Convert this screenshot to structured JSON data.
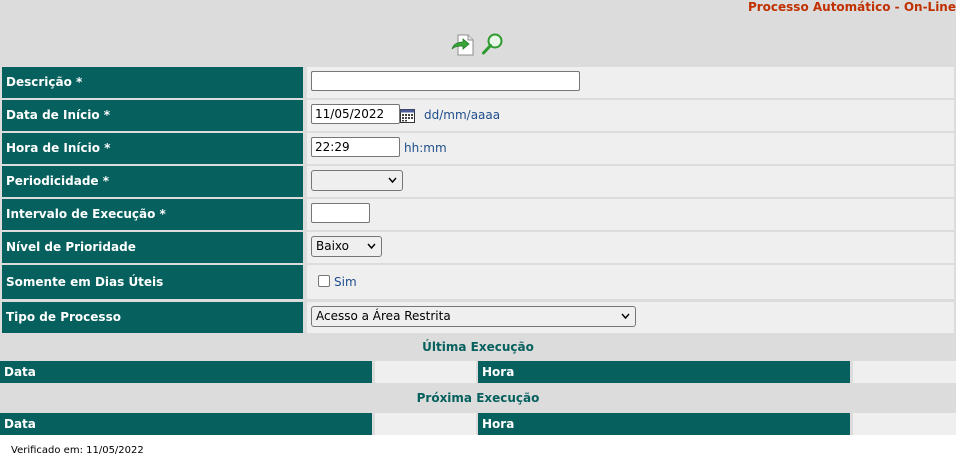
{
  "header": {
    "title": "Processo Automático - On-Line",
    "toolbar_icons": [
      "new-document-icon",
      "search-icon"
    ]
  },
  "colors": {
    "accent": "#05605e",
    "title": "#c03000",
    "hint": "#1f4e8c"
  },
  "form": {
    "descricao": {
      "label": "Descrição *",
      "value": ""
    },
    "data_inicio": {
      "label": "Data de Início *",
      "value": "11/05/2022",
      "hint": "dd/mm/aaaa"
    },
    "hora_inicio": {
      "label": "Hora de Início *",
      "value": "22:29",
      "hint": "hh:mm"
    },
    "periodicidade": {
      "label": "Periodicidade *",
      "selected": ""
    },
    "intervalo": {
      "label": "Intervalo de Execução *",
      "value": ""
    },
    "prioridade": {
      "label": "Nível de Prioridade",
      "selected": "Baixo"
    },
    "dias_uteis": {
      "label": "Somente em Dias Úteis",
      "checkbox_label": "Sim",
      "checked": false
    },
    "tipo_processo": {
      "label": "Tipo de Processo",
      "selected": "Acesso a Área Restrita"
    }
  },
  "ultima_execucao": {
    "title": "Última Execução",
    "data_label": "Data",
    "data_value": "",
    "hora_label": "Hora",
    "hora_value": ""
  },
  "proxima_execucao": {
    "title": "Próxima Execução",
    "data_label": "Data",
    "data_value": "",
    "hora_label": "Hora",
    "hora_value": ""
  },
  "footer": {
    "verified": "Verificado em: 11/05/2022"
  }
}
